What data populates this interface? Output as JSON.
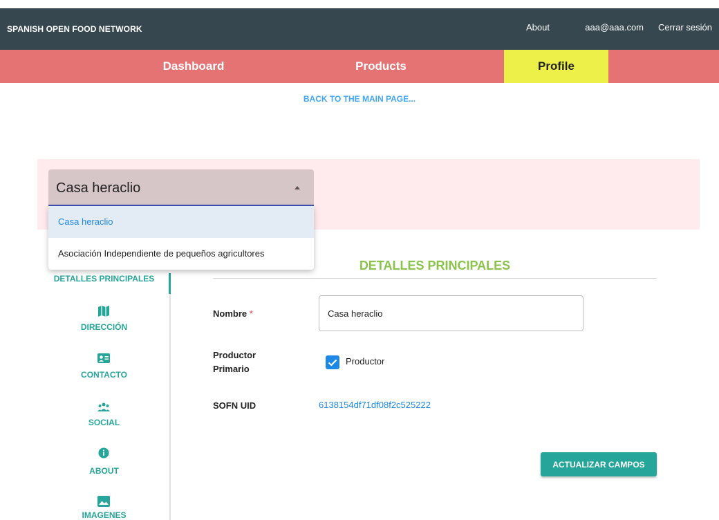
{
  "header": {
    "brand": "SPANISH OPEN FOOD NETWORK",
    "links": {
      "about": "About",
      "user_email": "aaa@aaa.com",
      "logout": "Cerrar sesión"
    }
  },
  "nav": {
    "dashboard": "Dashboard",
    "products": "Products",
    "profile": "Profile",
    "active": "Profile"
  },
  "back_link": "BACK TO THE MAIN PAGE...",
  "enterprise_select": {
    "value": "Casa heraclio",
    "options": [
      "Casa heraclio",
      "Asociación Independiente de pequeños agricultores"
    ],
    "selected_option": "Casa heraclio"
  },
  "sidebar": {
    "items": [
      {
        "label": "DETALLES PRINCIPALES",
        "icon": "none"
      },
      {
        "label": "DIRECCIÓN",
        "icon": "map-icon"
      },
      {
        "label": "CONTACTO",
        "icon": "contact-card-icon"
      },
      {
        "label": "SOCIAL",
        "icon": "people-icon"
      },
      {
        "label": "ABOUT",
        "icon": "info-icon"
      },
      {
        "label": "IMAGENES",
        "icon": "image-icon"
      }
    ],
    "active": "DETALLES PRINCIPALES"
  },
  "form": {
    "section_title": "DETALLES PRINCIPALES",
    "nombre_label": "Nombre",
    "required_mark": "*",
    "nombre_value": "Casa heraclio",
    "productor_label_line1": "Productor",
    "productor_label_line2": "Primario",
    "productor_checkbox_label": "Productor",
    "productor_checked": true,
    "uid_label": "SOFN UID",
    "uid_value": "6138154df71df08f2c525222",
    "submit_label": "ACTUALIZAR CAMPOS"
  },
  "colors": {
    "topbar": "#37474f",
    "navbar": "#e57373",
    "nav_active": "#eef04a",
    "accent_teal": "#26a69a",
    "section_title": "#8bc34a",
    "link_blue": "#1e88e5"
  }
}
